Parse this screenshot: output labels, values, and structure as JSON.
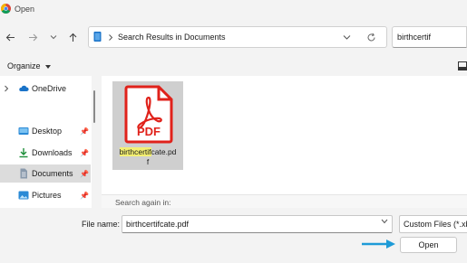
{
  "window": {
    "title": "Open"
  },
  "navigation": {
    "address": {
      "segments": [
        "Search Results in Documents"
      ]
    },
    "search": {
      "value": "birthcertif"
    }
  },
  "toolbar": {
    "organize_label": "Organize"
  },
  "sidebar": {
    "items": [
      {
        "label": "OneDrive",
        "icon": "cloud-icon",
        "expandable": true
      },
      {
        "label": "Desktop",
        "icon": "desktop-icon",
        "pinned": true
      },
      {
        "label": "Downloads",
        "icon": "download-icon",
        "pinned": true
      },
      {
        "label": "Documents",
        "icon": "document-icon",
        "pinned": true,
        "selected": true
      },
      {
        "label": "Pictures",
        "icon": "pictures-icon",
        "pinned": true
      }
    ]
  },
  "results": {
    "files": [
      {
        "name_match": "birthcertif",
        "name_rest_line1": "cate.pd",
        "name_line2": "f",
        "icon": "pdf-icon",
        "icon_text": "PDF"
      }
    ],
    "search_again_label": "Search again in:"
  },
  "footer": {
    "file_name_label": "File name:",
    "file_name_value": "birthcertifcate.pdf",
    "filter_value": "Custom Files (*.xb",
    "open_label": "Open"
  },
  "colors": {
    "pdf_red": "#e0221b",
    "arrow": "#1e9bd7",
    "match_highlight": "#f4f073",
    "folder_blue": "#1a73c8"
  }
}
